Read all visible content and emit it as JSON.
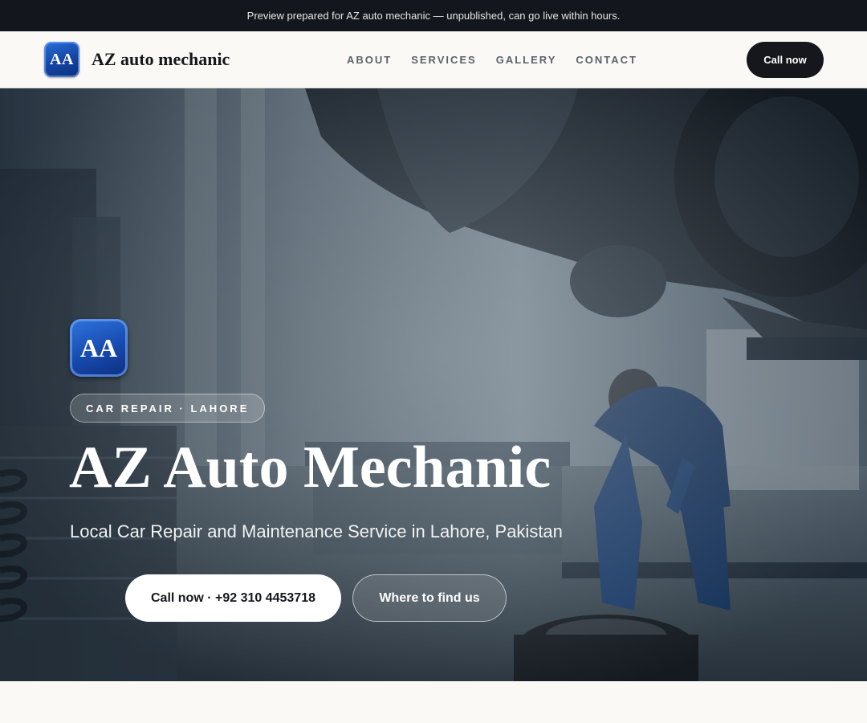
{
  "topbar": {
    "message": "Preview prepared for AZ auto mechanic — unpublished, can go live within hours."
  },
  "header": {
    "logo_text": "AA",
    "brand_name": "AZ auto mechanic",
    "nav": [
      {
        "label": "ABOUT"
      },
      {
        "label": "SERVICES"
      },
      {
        "label": "GALLERY"
      },
      {
        "label": "CONTACT"
      }
    ],
    "cta_label": "Call now"
  },
  "hero": {
    "logo_text": "AA",
    "tag": "CAR REPAIR · LAHORE",
    "title": "AZ Auto Mechanic",
    "subtitle": "Local Car Repair and Maintenance Service in Lahore, Pakistan",
    "primary_button": "Call now · +92 310 4453718",
    "secondary_button": "Where to find us"
  },
  "colors": {
    "dark": "#15171c",
    "brand_blue": "#1547a8",
    "page_bg": "#faf9f6"
  }
}
